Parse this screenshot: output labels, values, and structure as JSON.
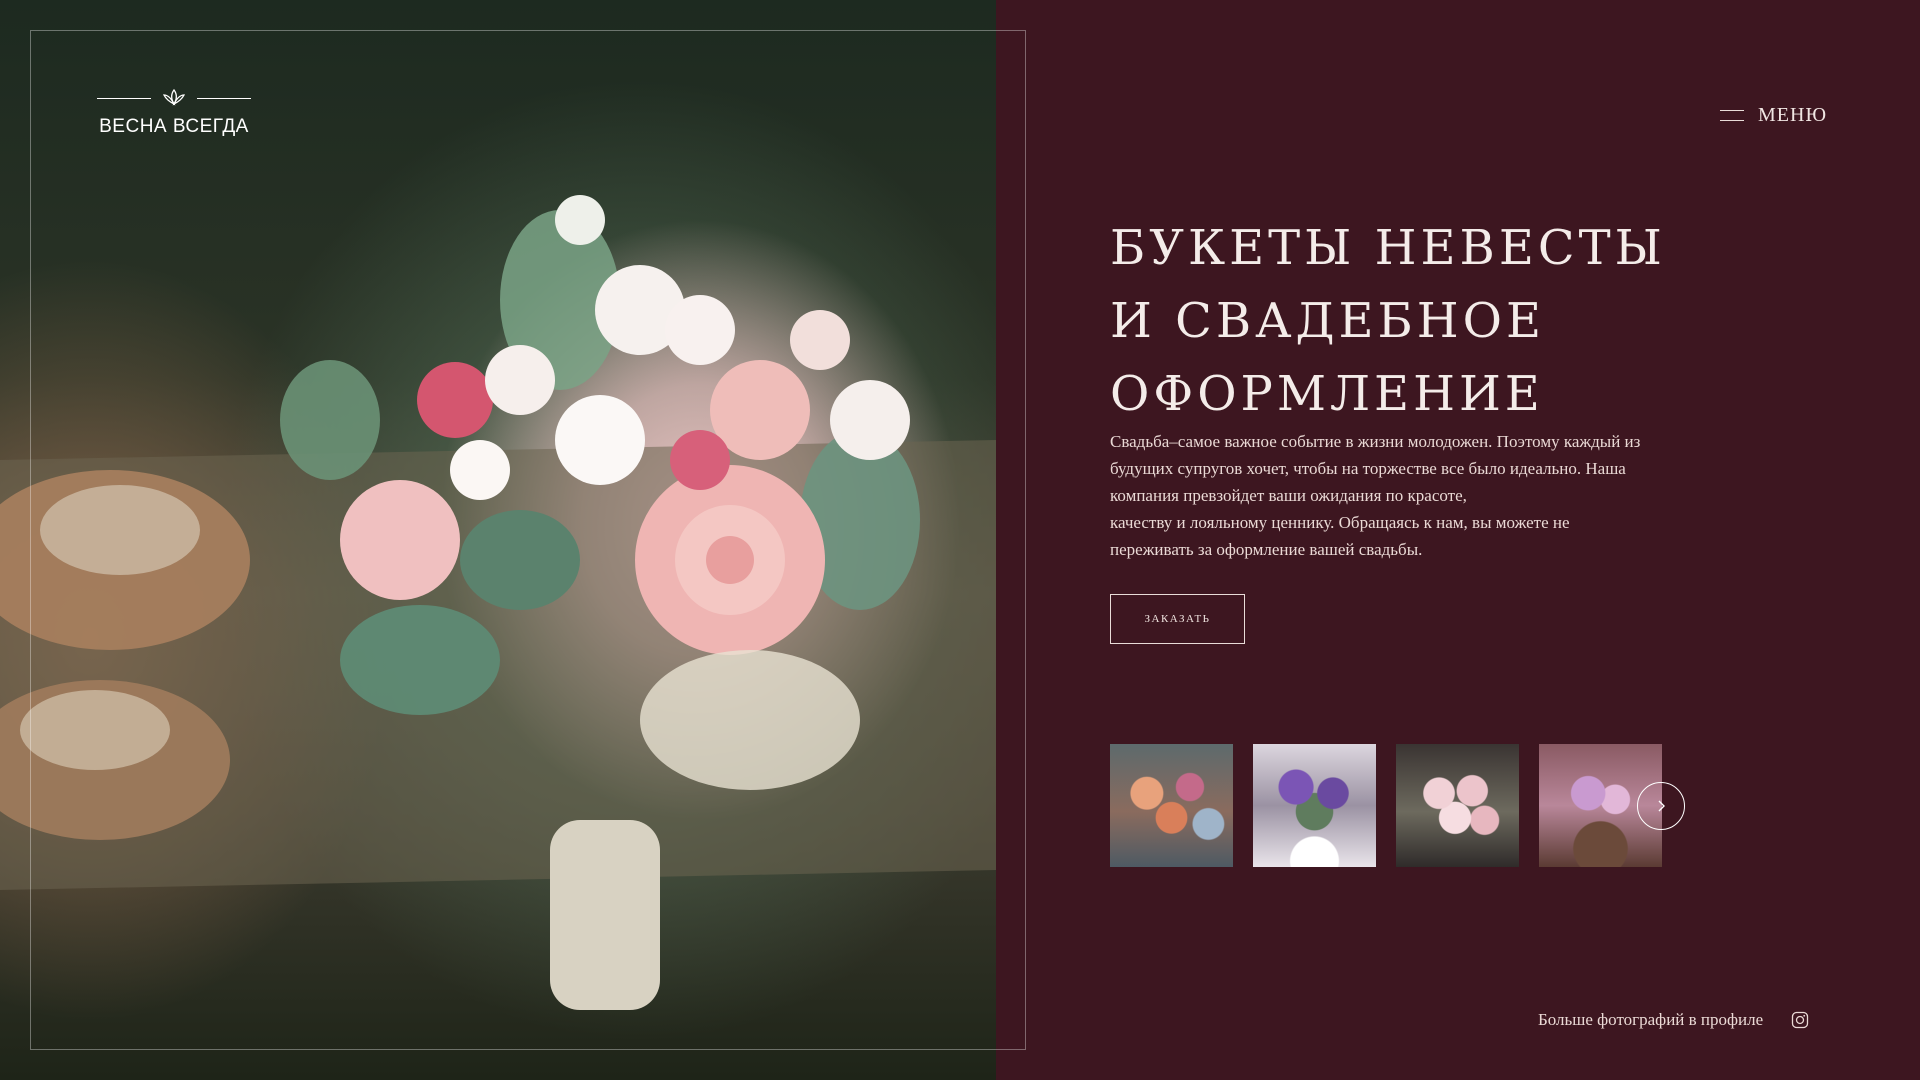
{
  "brand": {
    "name": "ВЕСНА ВСЕГДА",
    "logo_icon": "lotus-icon"
  },
  "header": {
    "menu_label": "МЕНЮ",
    "menu_icon": "hamburger-icon"
  },
  "hero": {
    "image": "bridal-bouquet-photo",
    "title_lines": [
      "БУКЕТЫ НЕВЕСТЫ",
      "И СВАДЕБНОЕ",
      "ОФОРМЛЕНИЕ"
    ],
    "description_lines": [
      "Свадьба–самое важное событие в жизни молодожен.  Поэтому каждый из",
      "будущих супругов хочет, чтобы на торжестве все было идеально. Наша",
      "компания превзойдет ваши ожидания по красоте,",
      "качеству и лояльному ценнику. Обращаясь к нам, вы можете не",
      "переживать за оформление вашей свадьбы."
    ],
    "cta_label": "ЗАКАЗАТЬ"
  },
  "gallery": {
    "thumbnails": [
      {
        "name": "bouquet-thumb-1"
      },
      {
        "name": "bouquet-thumb-2"
      },
      {
        "name": "bouquet-thumb-3"
      },
      {
        "name": "bouquet-thumb-4"
      }
    ],
    "next_icon": "chevron-right-icon"
  },
  "footer": {
    "profile_text": "Больше фотографий в профиле",
    "social_icon": "instagram-icon"
  },
  "colors": {
    "background": "#3d1620",
    "text": "#f4ece9",
    "border": "#e9dcd8"
  }
}
